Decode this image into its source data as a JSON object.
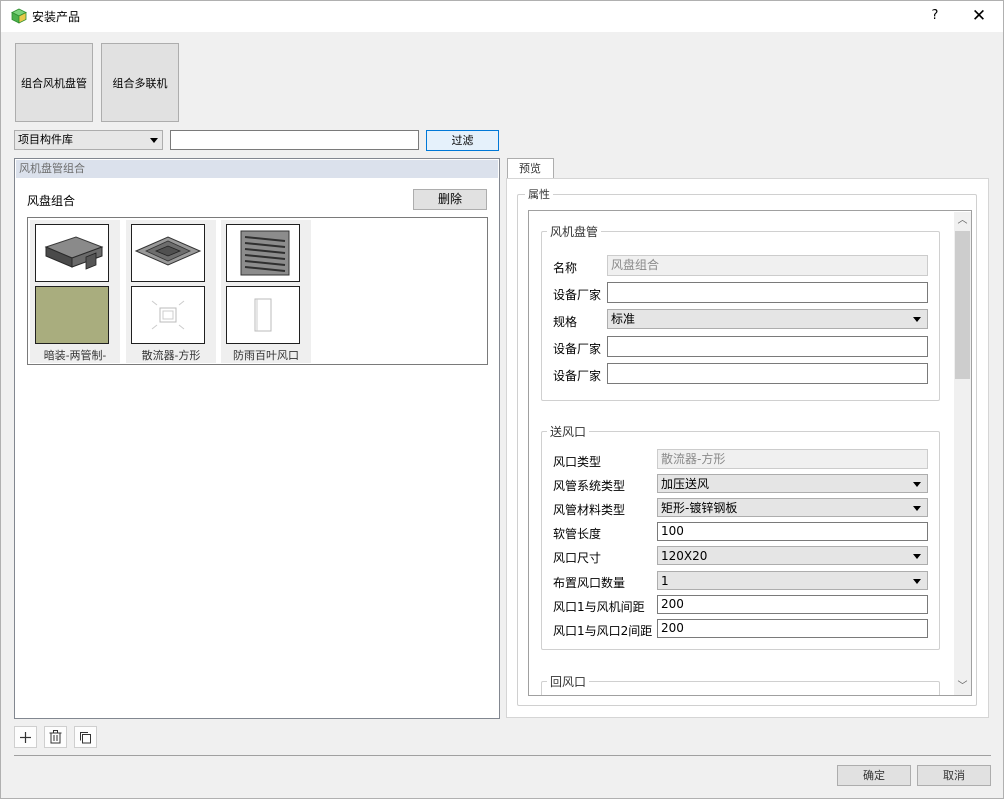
{
  "window": {
    "title": "安装产品",
    "help_label": "?",
    "close_label": "✕",
    "icon": "cube-icon"
  },
  "toolbar": {
    "buttons": [
      {
        "label": "组合风机盘管"
      },
      {
        "label": "组合多联机"
      }
    ]
  },
  "filter_bar": {
    "library_select": "项目构件库",
    "search_value": "",
    "filter_label": "过滤"
  },
  "left_panel": {
    "header": "风机盘管组合",
    "group_label": "风盘组合",
    "delete_label": "删除",
    "items": [
      {
        "caption": "暗装-两管制-",
        "top_icon": "fan-coil-unit-icon",
        "bottom_icon": "olive-swatch-icon"
      },
      {
        "caption": "散流器-方形",
        "top_icon": "square-diffuser-icon",
        "bottom_icon": "diffuser-plan-icon"
      },
      {
        "caption": "防雨百叶风口",
        "top_icon": "louver-grille-icon",
        "bottom_icon": "louver-outline-icon"
      }
    ]
  },
  "bottom_tools": [
    {
      "icon": "plus-icon",
      "glyph": "+"
    },
    {
      "icon": "trash-icon",
      "glyph": "🗑"
    },
    {
      "icon": "copy-icon",
      "glyph": "⧉"
    }
  ],
  "dialog_buttons": {
    "ok_label": "确定",
    "cancel_label": "取消"
  },
  "preview": {
    "tab_label": "预览",
    "properties_legend": "属性",
    "fan_coil": {
      "legend": "风机盘管",
      "name_label": "名称",
      "name_value": "风盘组合",
      "manufacturer_label_1": "设备厂家",
      "manufacturer_value_1": "",
      "spec_label": "规格",
      "spec_value": "标准",
      "manufacturer_label_2": "设备厂家",
      "manufacturer_value_2": "",
      "manufacturer_label_3": "设备厂家",
      "manufacturer_value_3": ""
    },
    "supply_outlet": {
      "legend": "送风口",
      "outlet_type_label": "风口类型",
      "outlet_type_value": "散流器-方形",
      "system_type_label": "风管系统类型",
      "system_type_value": "加压送风",
      "material_label": "风管材料类型",
      "material_value": "矩形-镀锌钢板",
      "hose_length_label": "软管长度",
      "hose_length_value": "100",
      "outlet_size_label": "风口尺寸",
      "outlet_size_value": "120X20",
      "outlet_count_label": "布置风口数量",
      "outlet_count_value": "1",
      "gap_fan_label": "风口1与风机间距",
      "gap_fan_value": "200",
      "gap_outlet_label": "风口1与风口2间距",
      "gap_outlet_value": "200"
    },
    "return_outlet": {
      "legend": "回风口"
    }
  }
}
